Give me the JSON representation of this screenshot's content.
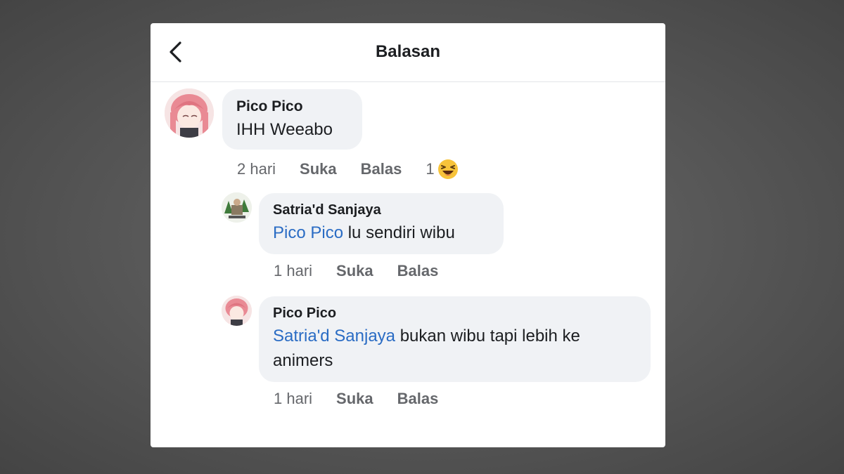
{
  "header": {
    "title": "Balasan"
  },
  "comments": [
    {
      "author": "Pico Pico",
      "text": "IHH Weeabo",
      "time": "2 hari",
      "like_label": "Suka",
      "reply_label": "Balas",
      "reaction_count": "1",
      "reaction_icon": "laughing-emoji"
    },
    {
      "author": "Satria'd Sanjaya",
      "mention": "Pico Pico",
      "text": " lu sendiri wibu",
      "time": "1 hari",
      "like_label": "Suka",
      "reply_label": "Balas"
    },
    {
      "author": "Pico Pico",
      "mention": "Satria'd Sanjaya",
      "text": " bukan wibu tapi lebih ke animers",
      "time": "1 hari",
      "like_label": "Suka",
      "reply_label": "Balas"
    }
  ],
  "colors": {
    "mention": "#2a6cc4",
    "bubble": "#f0f2f5",
    "meta": "#65676b"
  }
}
